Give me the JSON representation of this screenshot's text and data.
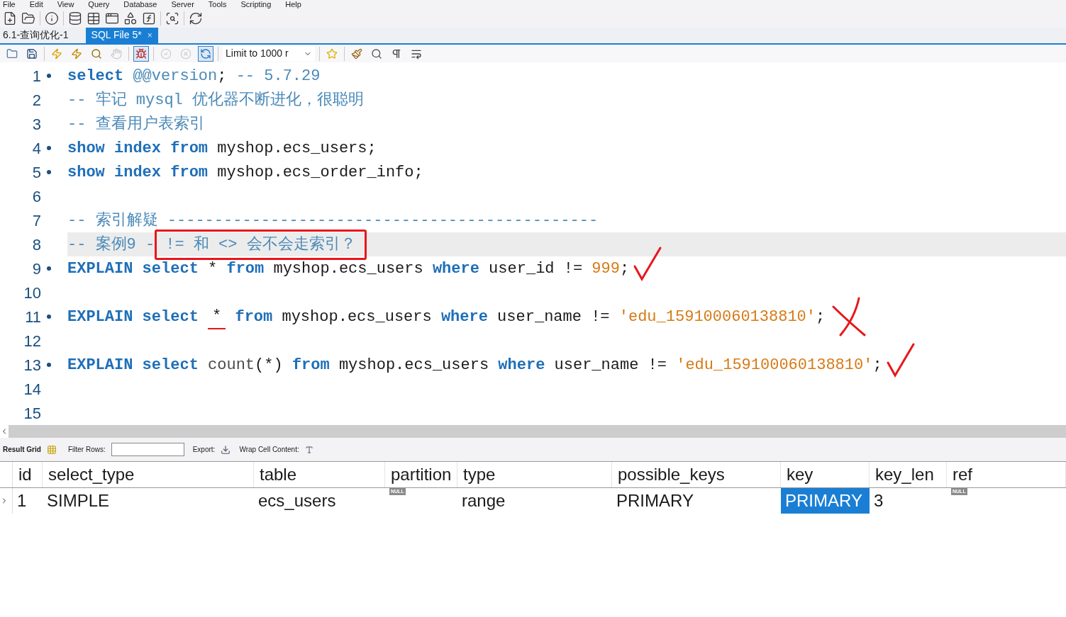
{
  "menu": [
    "File",
    "Edit",
    "View",
    "Query",
    "Database",
    "Server",
    "Tools",
    "Scripting",
    "Help"
  ],
  "main_toolbar": [
    {
      "kind": "new-sql"
    },
    {
      "kind": "open-sql"
    },
    {
      "kind": "sep"
    },
    {
      "kind": "info"
    },
    {
      "kind": "sep"
    },
    {
      "kind": "schema"
    },
    {
      "kind": "table"
    },
    {
      "kind": "view"
    },
    {
      "kind": "procedure"
    },
    {
      "kind": "function"
    },
    {
      "kind": "sep"
    },
    {
      "kind": "inspect"
    },
    {
      "kind": "sep"
    },
    {
      "kind": "reconnect"
    }
  ],
  "tabs": [
    {
      "label": "6.1-查询优化-1",
      "selected": false
    },
    {
      "label": "SQL File 5*",
      "selected": true,
      "close": "×"
    }
  ],
  "editor_toolbar": [
    {
      "kind": "open",
      "selected": false,
      "disabled": false
    },
    {
      "kind": "save",
      "selected": false,
      "disabled": false
    },
    {
      "kind": "sep"
    },
    {
      "kind": "execute",
      "selected": false,
      "disabled": false
    },
    {
      "kind": "execute-current",
      "selected": false,
      "disabled": false
    },
    {
      "kind": "explain",
      "selected": false,
      "disabled": false
    },
    {
      "kind": "stop",
      "selected": false,
      "disabled": true
    },
    {
      "kind": "sep"
    },
    {
      "kind": "toggle-error",
      "selected": true,
      "disabled": false
    },
    {
      "kind": "sep"
    },
    {
      "kind": "commit",
      "selected": false,
      "disabled": true
    },
    {
      "kind": "rollback",
      "selected": false,
      "disabled": true
    },
    {
      "kind": "autocommit",
      "selected": true,
      "disabled": false
    },
    {
      "kind": "sep"
    },
    {
      "kind": "limit",
      "label": "Limit to 1000 r"
    },
    {
      "kind": "sep"
    },
    {
      "kind": "snippet",
      "selected": false,
      "disabled": false
    },
    {
      "kind": "sep"
    },
    {
      "kind": "beautify",
      "selected": false,
      "disabled": false
    },
    {
      "kind": "find",
      "selected": false,
      "disabled": false
    },
    {
      "kind": "invisibles",
      "selected": false,
      "disabled": false
    },
    {
      "kind": "wrap",
      "selected": false,
      "disabled": false
    }
  ],
  "code_lines": [
    {
      "number": "1",
      "statement": true,
      "current": false,
      "tokens": [
        {
          "kind": "keyword",
          "text": "select "
        },
        {
          "kind": "comment",
          "text": "@@version"
        },
        {
          "kind": "plain",
          "text": "; "
        },
        {
          "kind": "comment",
          "text": "-- 5.7.29"
        }
      ]
    },
    {
      "number": "2",
      "statement": false,
      "current": false,
      "tokens": [
        {
          "kind": "comment",
          "text": "-- 牢记 mysql 优化器不断进化，很聪明"
        }
      ]
    },
    {
      "number": "3",
      "statement": false,
      "current": false,
      "tokens": [
        {
          "kind": "comment",
          "text": "-- 查看用户表索引"
        }
      ]
    },
    {
      "number": "4",
      "statement": true,
      "current": false,
      "tokens": [
        {
          "kind": "keyword",
          "text": "show index from"
        },
        {
          "kind": "plain",
          "text": " myshop.ecs_users;"
        }
      ]
    },
    {
      "number": "5",
      "statement": true,
      "current": false,
      "tokens": [
        {
          "kind": "keyword",
          "text": "show index from"
        },
        {
          "kind": "plain",
          "text": " myshop.ecs_order_info;"
        }
      ]
    },
    {
      "number": "6",
      "statement": false,
      "current": false
    },
    {
      "number": "7",
      "statement": false,
      "current": false,
      "tokens": [
        {
          "kind": "comment",
          "text": "-- 索引解疑 ----------------------------------------------"
        }
      ]
    },
    {
      "number": "8",
      "statement": false,
      "current": true,
      "tokens": [
        {
          "kind": "comment",
          "text": "-- 案例9 -"
        },
        {
          "kind": "comment",
          "text": "!= 和 <> 会不会走索引？",
          "boxed": true
        }
      ]
    },
    {
      "number": "9",
      "statement": true,
      "current": false,
      "annotations": [
        {
          "kind": "check"
        }
      ],
      "tokens": [
        {
          "kind": "keyword",
          "text": "EXPLAIN select"
        },
        {
          "kind": "plain",
          "text": " * "
        },
        {
          "kind": "keyword",
          "text": "from"
        },
        {
          "kind": "plain",
          "text": " myshop.ecs_users "
        },
        {
          "kind": "keyword",
          "text": "where"
        },
        {
          "kind": "plain",
          "text": " user_id != "
        },
        {
          "kind": "number",
          "text": "999"
        },
        {
          "kind": "plain",
          "text": ";"
        }
      ]
    },
    {
      "number": "10",
      "statement": false,
      "current": false
    },
    {
      "number": "11",
      "statement": true,
      "current": false,
      "annotations": [
        {
          "kind": "cross"
        }
      ],
      "tokens": [
        {
          "kind": "keyword",
          "text": "EXPLAIN select "
        },
        {
          "kind": "plain",
          "text": "*",
          "underlined": true
        },
        {
          "kind": "keyword",
          "text": " from"
        },
        {
          "kind": "plain",
          "text": " myshop.ecs_users "
        },
        {
          "kind": "keyword",
          "text": "where"
        },
        {
          "kind": "plain",
          "text": " user_name != "
        },
        {
          "kind": "string",
          "text": "'edu_159100060138810'"
        },
        {
          "kind": "plain",
          "text": ";"
        }
      ]
    },
    {
      "number": "12",
      "statement": false,
      "current": false
    },
    {
      "number": "13",
      "statement": true,
      "current": false,
      "annotations": [
        {
          "kind": "check"
        }
      ],
      "tokens": [
        {
          "kind": "keyword",
          "text": "EXPLAIN select "
        },
        {
          "kind": "function",
          "text": "count"
        },
        {
          "kind": "plain",
          "text": "(*) "
        },
        {
          "kind": "keyword",
          "text": "from"
        },
        {
          "kind": "plain",
          "text": " myshop.ecs_users "
        },
        {
          "kind": "keyword",
          "text": "where"
        },
        {
          "kind": "plain",
          "text": " user_name != "
        },
        {
          "kind": "string",
          "text": "'edu_159100060138810'"
        },
        {
          "kind": "plain",
          "text": ";"
        }
      ]
    },
    {
      "number": "14",
      "statement": false,
      "current": false
    },
    {
      "number": "15",
      "statement": false,
      "current": false
    }
  ],
  "result_toolbar": {
    "result_grid": "Result Grid",
    "filter_label": "Filter Rows:",
    "export_label": "Export:",
    "wrap_label": "Wrap Cell Content:"
  },
  "result_grid": {
    "columns": [
      "id",
      "select_type",
      "table",
      "partition",
      "type",
      "possible_keys",
      "key",
      "key_len",
      "ref"
    ],
    "rows": [
      {
        "cells": [
          {
            "text": "1",
            "selected": false
          },
          {
            "text": "SIMPLE",
            "selected": false
          },
          {
            "text": "ecs_users",
            "selected": false
          },
          {
            "text": "NULL",
            "kind": "null",
            "selected": false
          },
          {
            "text": "range",
            "selected": false
          },
          {
            "text": "PRIMARY",
            "selected": false
          },
          {
            "text": "PRIMARY",
            "selected": true
          },
          {
            "text": "3",
            "selected": false
          },
          {
            "text": "NULL",
            "kind": "null",
            "selected": false
          }
        ]
      }
    ]
  }
}
